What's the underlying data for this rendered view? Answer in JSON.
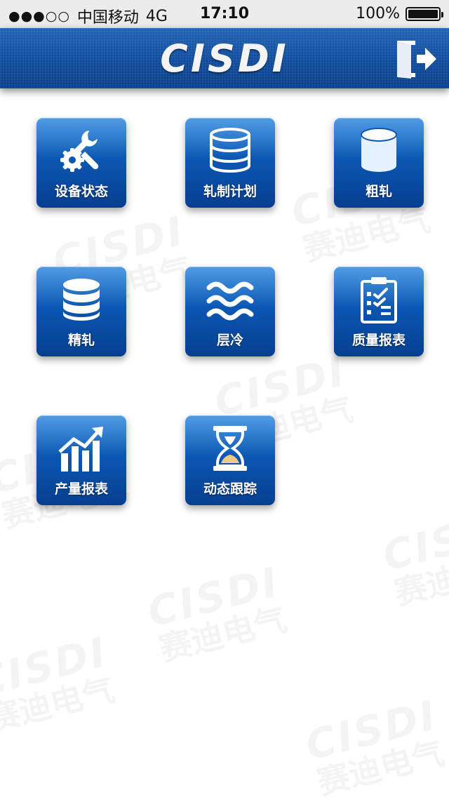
{
  "status_bar": {
    "signal": "●●●○○",
    "carrier": "中国移动",
    "network": "4G",
    "time": "17:10",
    "battery": "100%",
    "battery_level": 1.0
  },
  "header": {
    "logo": "CISDI",
    "exit_icon": "exit-door-icon"
  },
  "watermark": {
    "brand": "CISDI",
    "company": "赛迪电气"
  },
  "menu": {
    "items": [
      {
        "label": "设备状态",
        "icon": "wrench-gear-icon"
      },
      {
        "label": "轧制计划",
        "icon": "database-stack-icon"
      },
      {
        "label": "粗轧",
        "icon": "cylinder-icon"
      },
      {
        "label": "精轧",
        "icon": "database-stack-icon"
      },
      {
        "label": "层冷",
        "icon": "wave-icon"
      },
      {
        "label": "质量报表",
        "icon": "clipboard-checklist-icon"
      },
      {
        "label": "产量报表",
        "icon": "bar-chart-trend-icon"
      },
      {
        "label": "动态跟踪",
        "icon": "hourglass-icon"
      }
    ]
  },
  "colors": {
    "nav_bar": "#0d4a9c",
    "tile": "#0b57b3",
    "icon": "#ffffff"
  }
}
